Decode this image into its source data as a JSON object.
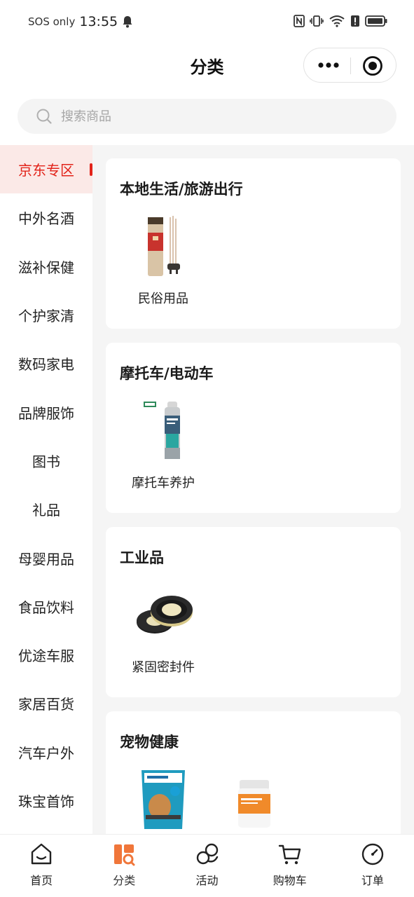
{
  "status_bar": {
    "carrier": "SOS only",
    "time": "13:55"
  },
  "nav": {
    "title": "分类"
  },
  "search": {
    "placeholder": "搜索商品"
  },
  "sidebar": {
    "items": [
      {
        "label": "京东专区",
        "active": true
      },
      {
        "label": "中外名酒"
      },
      {
        "label": "滋补保健"
      },
      {
        "label": "个护家清"
      },
      {
        "label": "数码家电"
      },
      {
        "label": "品牌服饰"
      },
      {
        "label": "图书"
      },
      {
        "label": "礼品"
      },
      {
        "label": "母婴用品"
      },
      {
        "label": "食品饮料"
      },
      {
        "label": "优途车服"
      },
      {
        "label": "家居百货"
      },
      {
        "label": "汽车户外"
      },
      {
        "label": "珠宝首饰"
      }
    ]
  },
  "sections": [
    {
      "title": "本地生活/旅游出行",
      "items": [
        {
          "label": "民俗用品",
          "image": "incense-image"
        }
      ]
    },
    {
      "title": "摩托车/电动车",
      "items": [
        {
          "label": "摩托车养护",
          "image": "spray-can-image"
        }
      ]
    },
    {
      "title": "工业品",
      "items": [
        {
          "label": "紧固密封件",
          "image": "tape-rolls-image"
        }
      ]
    },
    {
      "title": "宠物健康",
      "items": [
        {
          "label": "",
          "image": "pet-chews-image"
        },
        {
          "label": "",
          "image": "pet-supplement-image"
        }
      ]
    }
  ],
  "tabbar": {
    "items": [
      {
        "label": "首页",
        "icon": "home-icon"
      },
      {
        "label": "分类",
        "icon": "category-icon",
        "active": true
      },
      {
        "label": "活动",
        "icon": "activity-icon"
      },
      {
        "label": "购物车",
        "icon": "cart-icon"
      },
      {
        "label": "订单",
        "icon": "order-icon"
      }
    ]
  },
  "colors": {
    "accent": "#e2231a",
    "active_bg": "#fbe9e7",
    "tab_active": "#f0763a",
    "page_bg": "#f5f5f5"
  }
}
